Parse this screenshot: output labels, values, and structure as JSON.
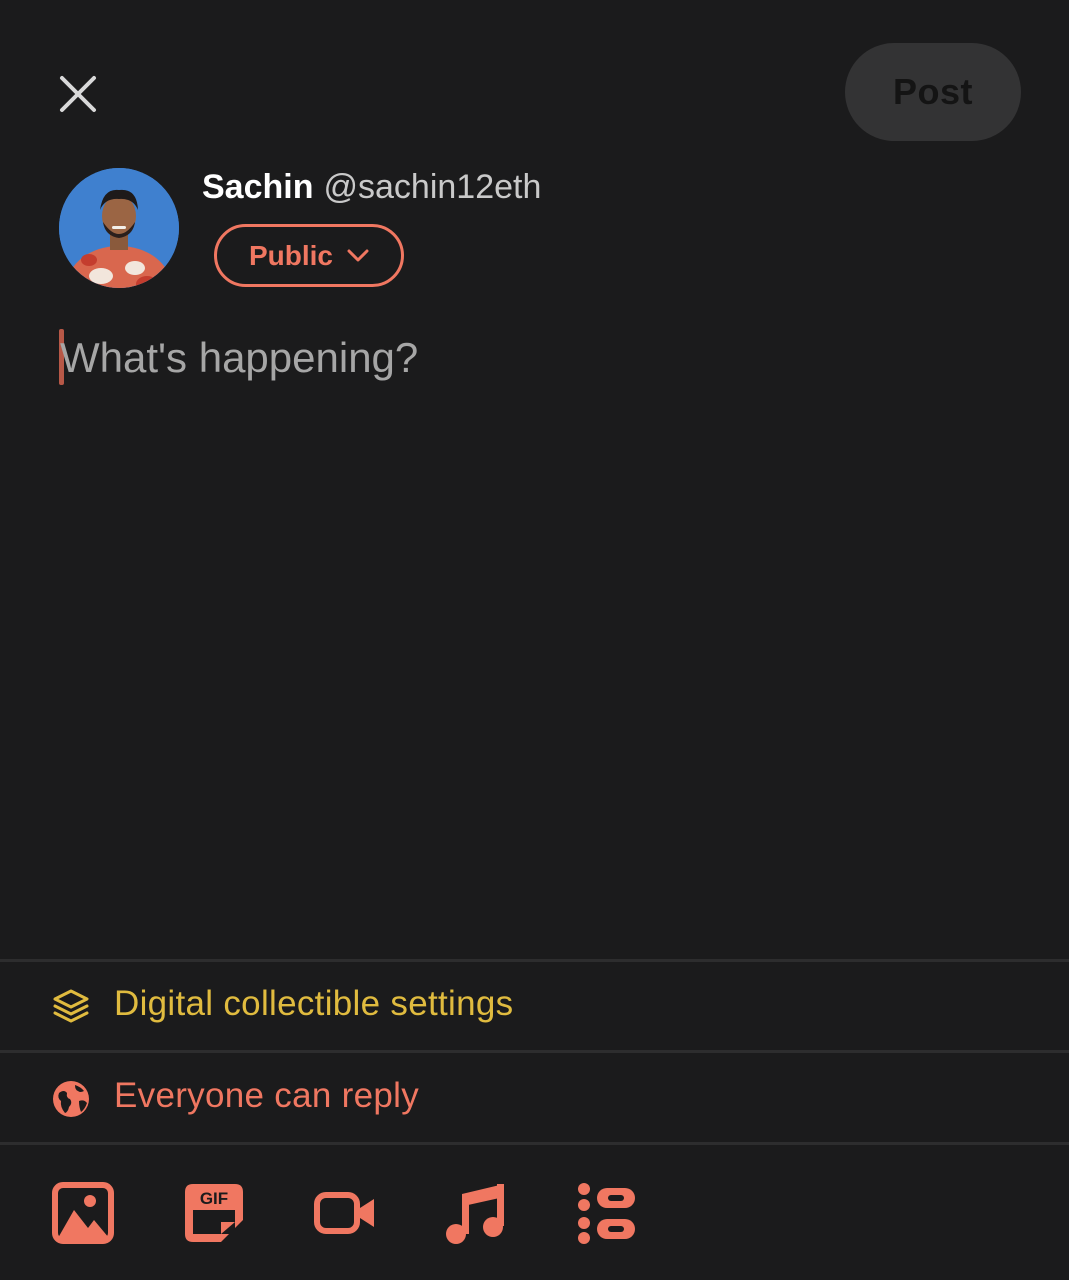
{
  "header": {
    "post_label": "Post"
  },
  "author": {
    "name": "Sachin",
    "handle": "@sachin12eth",
    "audience_label": "Public"
  },
  "compose": {
    "placeholder": "What's happening?"
  },
  "settings": {
    "collectible_label": "Digital collectible settings",
    "reply_label": "Everyone can reply"
  },
  "toolbar": {
    "gif_text": "GIF"
  },
  "colors": {
    "background": "#1b1b1c",
    "accent": "#f07761",
    "collectible": "#e0bb3f",
    "post_button_bg": "#333334"
  },
  "icons": [
    "close-icon",
    "chevron-down-icon",
    "layers-icon",
    "globe-icon",
    "image-icon",
    "gif-icon",
    "video-icon",
    "music-icon",
    "poll-icon"
  ]
}
